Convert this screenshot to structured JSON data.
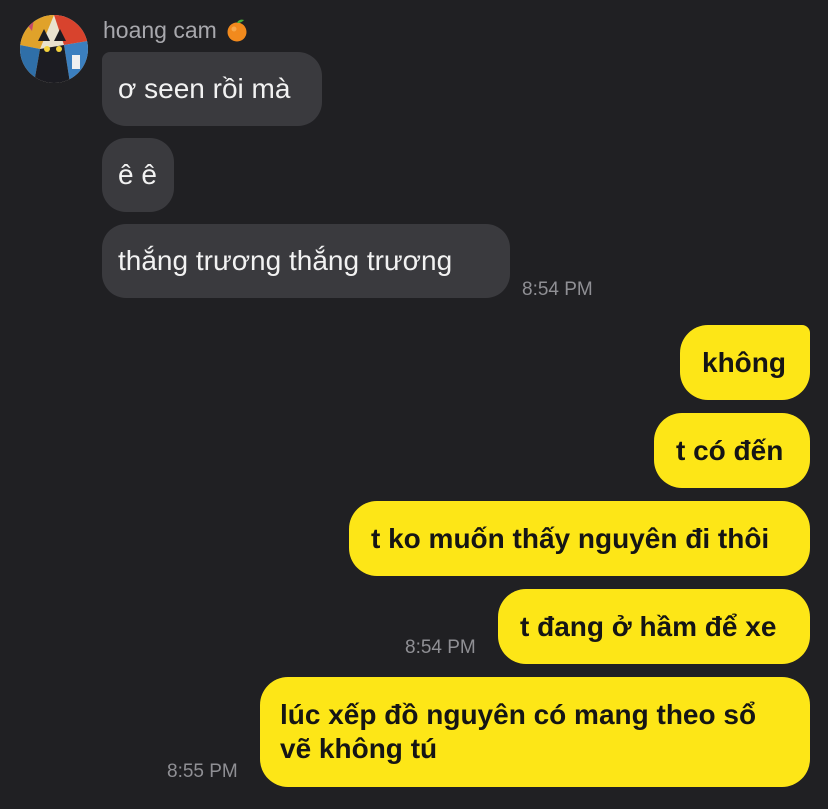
{
  "chat": {
    "sender_name": "hoang cam",
    "sender_emoji_icon": "tangerine-icon",
    "incoming": [
      {
        "text": "ơ seen rồi mà"
      },
      {
        "text": "ê ê"
      },
      {
        "text": "thắng trương thắng trương"
      }
    ],
    "incoming_time": "8:54 PM",
    "outgoing": [
      {
        "text": "không"
      },
      {
        "text": "t có đến"
      },
      {
        "text": "t ko muốn thấy nguyên đi thôi"
      },
      {
        "text": "t đang ở hầm để xe"
      }
    ],
    "outgoing_time": "8:54 PM",
    "last_message": {
      "line1": "lúc xếp đồ nguyên có mang theo sổ",
      "line2": "vẽ không tú",
      "time": "8:55 PM"
    }
  },
  "colors": {
    "background": "#202023",
    "incoming_bubble": "#3a3a3e",
    "outgoing_bubble": "#fde617"
  }
}
